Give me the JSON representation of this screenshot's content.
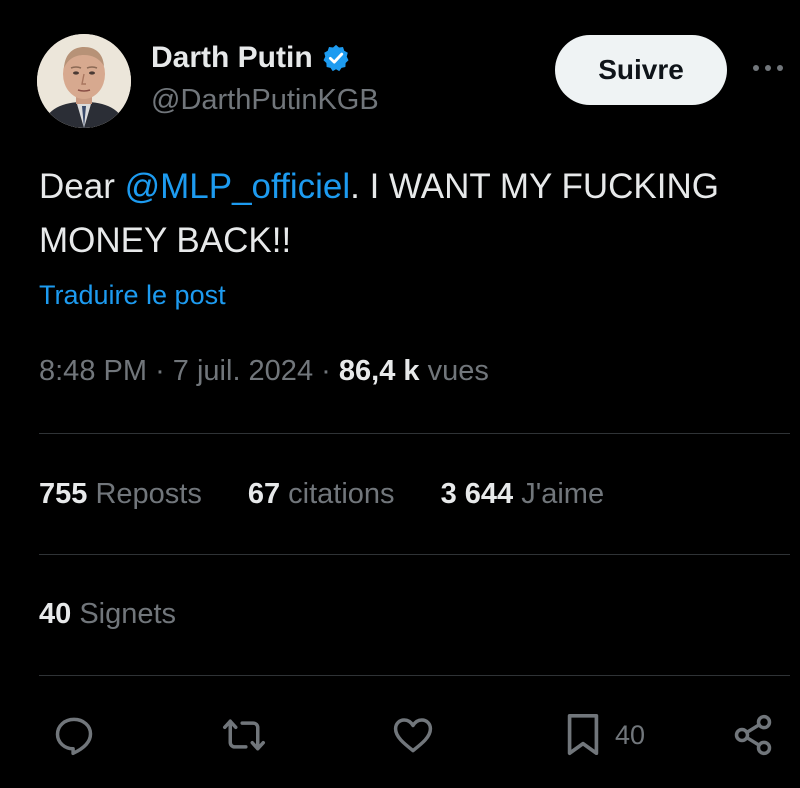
{
  "author": {
    "display_name": "Darth Putin",
    "handle": "@DarthPutinKGB",
    "verified": true,
    "avatar_icon": "profile-photo"
  },
  "header": {
    "follow_label": "Suivre",
    "more_icon": "more-horizontal-icon"
  },
  "tweet": {
    "text_before_mention": "Dear ",
    "mention": "@MLP_officiel",
    "text_after_mention": ". I WANT MY FUCKING MONEY BACK!!",
    "translate_label": "Traduire le post"
  },
  "meta": {
    "time": "8:48 PM",
    "date": "7 juil. 2024",
    "separator": "·",
    "views_count": "86,4 k",
    "views_label": "vues"
  },
  "stats": {
    "reposts_count": "755",
    "reposts_label": "Reposts",
    "quotes_count": "67",
    "quotes_label": "citations",
    "likes_count": "3 644",
    "likes_label": "J'aime",
    "bookmarks_count": "40",
    "bookmarks_label": "Signets"
  },
  "actions": {
    "bookmark_count": "40"
  },
  "colors": {
    "background": "#000000",
    "accent": "#1d9bf0",
    "primary_text": "#e7e9ea",
    "secondary_text": "#71767b",
    "divider": "#2f3336"
  }
}
